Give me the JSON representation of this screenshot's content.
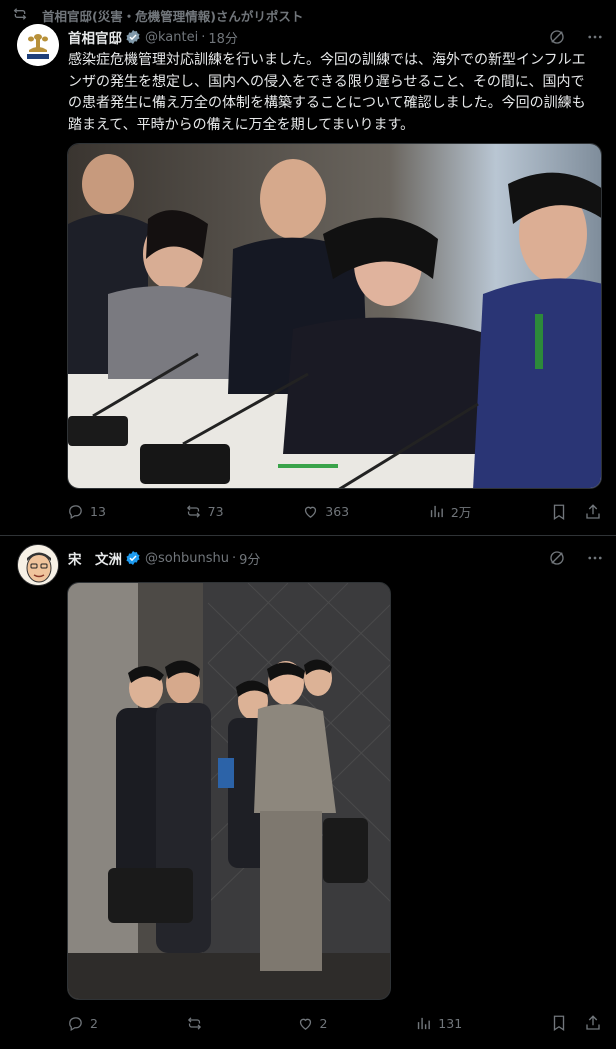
{
  "tweet1": {
    "repost_label": "首相官邸(災害・危機管理情報)さんがリポスト",
    "author_name": "首相官邸",
    "handle": "@kantei",
    "separator": "·",
    "time": "18分",
    "text": "感染症危機管理対応訓練を行いました。今回の訓練では、海外での新型インフルエンザの発生を想定し、国内への侵入をできる限り遅らせること、その間に、国内での患者発生に備え万全の体制を構築することについて確認しました。今回の訓練も踏まえて、平時からの備えに万全を期してまいります。",
    "actions": {
      "replies": "13",
      "reposts": "73",
      "likes": "363",
      "views": "2万"
    },
    "colors": {
      "verified_badge": "#829aab"
    }
  },
  "tweet2": {
    "author_name": "宋　文洲",
    "handle": "@sohbunshu",
    "separator": "·",
    "time": "9分",
    "actions": {
      "replies": "2",
      "reposts": "",
      "likes": "2",
      "views": "131"
    },
    "colors": {
      "verified_badge": "#1d9bf0"
    }
  },
  "icons": [
    "repost-icon",
    "grok-icon",
    "more-icon",
    "reply-icon",
    "like-icon",
    "views-icon",
    "bookmark-icon",
    "share-icon",
    "verified-badge-icon"
  ]
}
